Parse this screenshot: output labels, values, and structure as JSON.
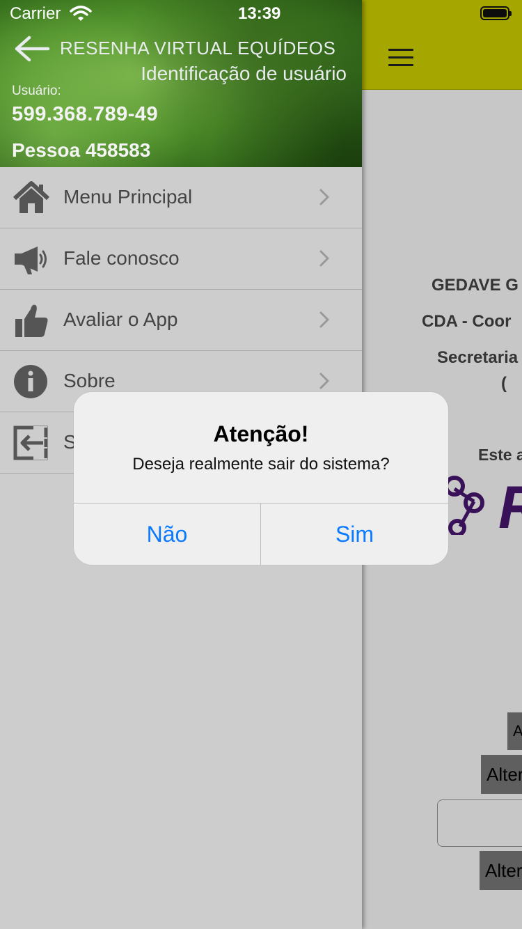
{
  "status_bar": {
    "carrier": "Carrier",
    "time": "13:39"
  },
  "drawer": {
    "header": {
      "title": "RESENHA VIRTUAL EQUÍDEOS",
      "subtitle": "Identificação de usuário",
      "user_label": "Usuário:",
      "user_cpf": "599.368.789-49",
      "user_name": "Pessoa 458583"
    },
    "menu_items": [
      {
        "label": "Menu Principal",
        "icon": "home-icon"
      },
      {
        "label": "Fale conosco",
        "icon": "megaphone-icon"
      },
      {
        "label": "Avaliar o App",
        "icon": "thumbs-up-icon"
      },
      {
        "label": "Sobre",
        "icon": "info-icon"
      },
      {
        "label": "S",
        "icon": "exit-icon"
      }
    ]
  },
  "main": {
    "lines": [
      "GEDAVE G",
      "CDA - Coor",
      "Secretaria",
      "Este a"
    ],
    "logo_letter": "R",
    "alt_buttons": [
      "Al",
      "Alter",
      "Alter"
    ],
    "accent_color": "#d4d500",
    "logo_color": "#4a1672"
  },
  "alert": {
    "title": "Atenção!",
    "message": "Deseja realmente sair do sistema?",
    "cancel_label": "Não",
    "confirm_label": "Sim",
    "button_color": "#0a7aff"
  }
}
